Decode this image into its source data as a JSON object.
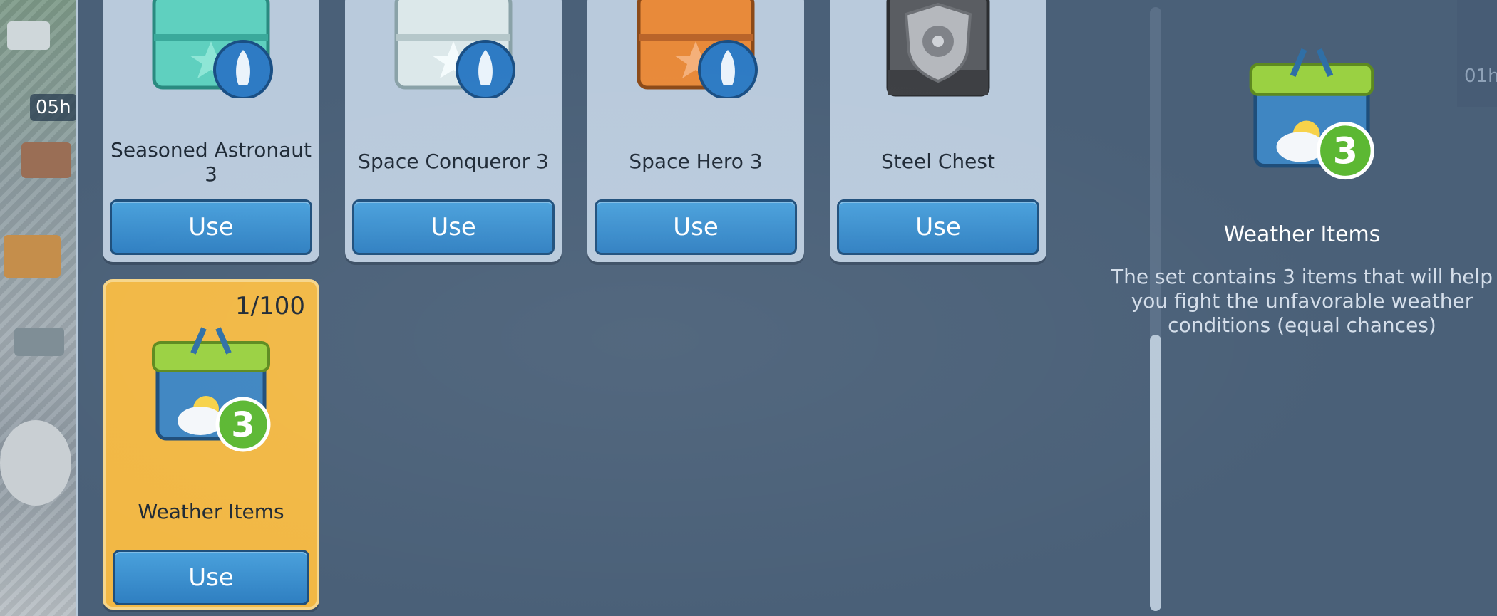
{
  "background": {
    "timer": "05h",
    "right_timer": "01h"
  },
  "items": [
    {
      "name": "Seasoned Astronaut 3",
      "button": "Use",
      "chest": "teal-chest-icon"
    },
    {
      "name": "Space Conqueror 3",
      "button": "Use",
      "chest": "silver-chest-icon"
    },
    {
      "name": "Space Hero 3",
      "button": "Use",
      "chest": "orange-chest-icon"
    },
    {
      "name": "Steel Chest",
      "button": "Use",
      "chest": "steel-chest-icon"
    },
    {
      "name": "Weather Items",
      "button": "Use",
      "quantity": "1/100",
      "chest": "weather-chest-icon",
      "selected": true
    }
  ],
  "detail": {
    "title": "Weather Items",
    "description": "The set contains 3 items that will help you fight the unfavorable weather conditions (equal chances)",
    "badge": "3"
  },
  "colors": {
    "panel": "#4a6078",
    "card": "#b9cadc",
    "selected": "#f2b845",
    "button": "#3a8fd0",
    "badge": "#5cb833"
  }
}
